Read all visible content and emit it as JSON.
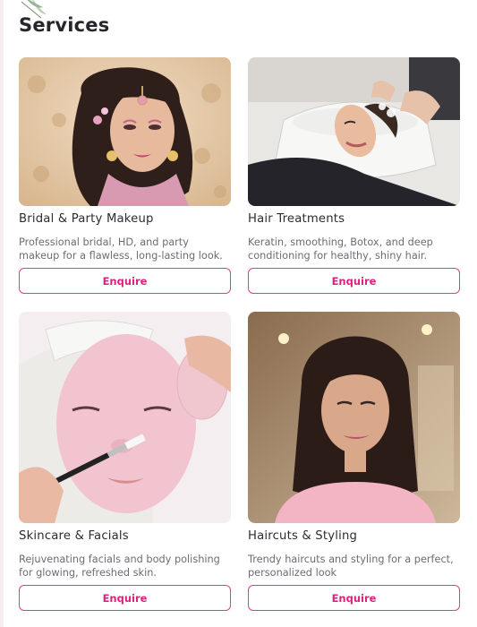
{
  "header": {
    "title": "Services"
  },
  "theme": {
    "accent": "#e63a8e",
    "accent_text": "#d9237d",
    "title_color": "#25252b",
    "desc_color": "#6c6c74"
  },
  "services": [
    {
      "title": "Bridal & Party Makeup",
      "description": "Professional bridal, HD, and party makeup for a flawless, long-lasting look.",
      "button_label": "Enquire",
      "image": "bridal-makeup-photo"
    },
    {
      "title": "Hair Treatments",
      "description": "Keratin, smoothing, Botox, and deep conditioning for healthy, shiny hair.",
      "button_label": "Enquire",
      "image": "hair-wash-photo"
    },
    {
      "title": "Skincare & Facials",
      "description": "Rejuvenating facials and body polishing for glowing, refreshed skin.",
      "button_label": "Enquire",
      "image": "facial-mask-photo"
    },
    {
      "title": "Haircuts & Styling",
      "description": "Trendy haircuts and styling for a perfect, personalized look",
      "button_label": "Enquire",
      "image": "haircut-styling-photo"
    }
  ]
}
